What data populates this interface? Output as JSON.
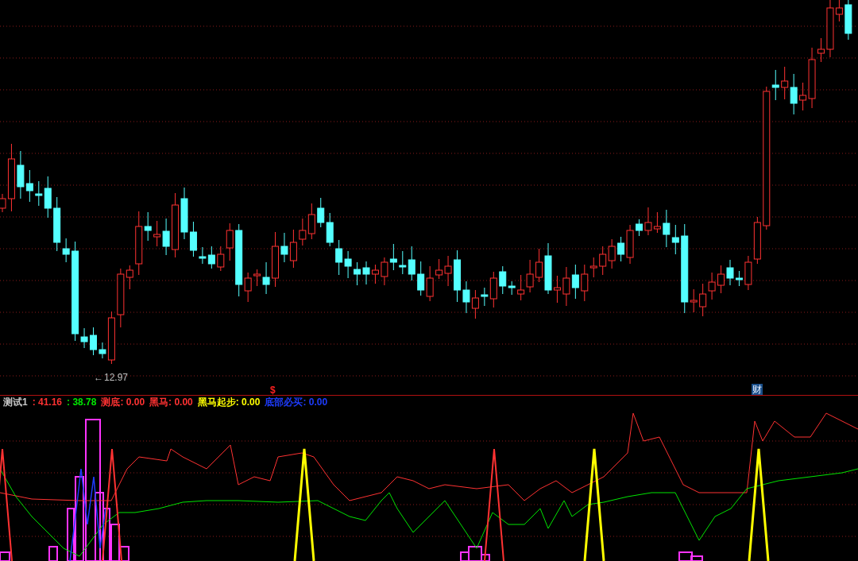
{
  "price_panel": {
    "low_marker": {
      "arrow": "←",
      "value": "12.97"
    },
    "signal_marker": "$",
    "event_marker": "财"
  },
  "indicator_legend": {
    "name": "测试1",
    "items": [
      {
        "text": ": 41.16",
        "color": "#ff3232"
      },
      {
        "text": ": 38.78",
        "color": "#00e600"
      },
      {
        "text": "测底: 0.00",
        "color": "#ff3232"
      },
      {
        "text": "黑马: 0.00",
        "color": "#ff3232"
      },
      {
        "text": "黑马起步: 0.00",
        "color": "#ffff00"
      },
      {
        "text": "底部必买: 0.00",
        "color": "#1e3cff"
      }
    ]
  }
}
